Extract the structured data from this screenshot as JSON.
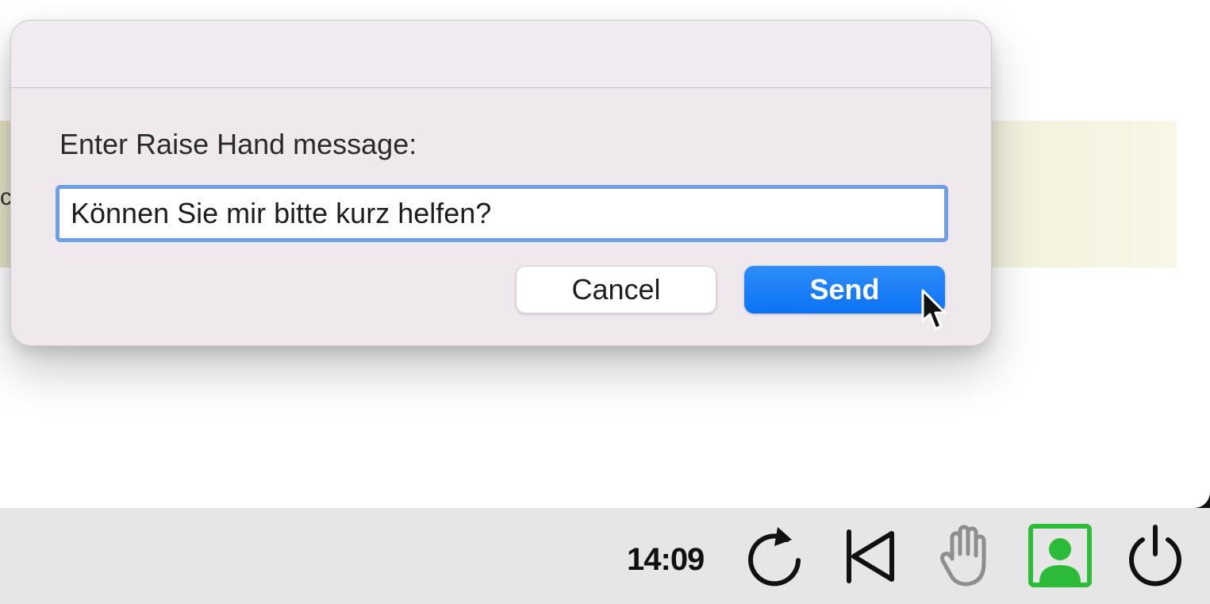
{
  "background": {
    "banner_fragment": "c"
  },
  "dialog": {
    "prompt": "Enter Raise Hand message:",
    "input_value": "Können Sie mir bitte kurz helfen?",
    "cancel_label": "Cancel",
    "send_label": "Send"
  },
  "taskbar": {
    "time": "14:09",
    "icons": [
      "reload-icon",
      "back-icon",
      "raise-hand-icon",
      "profile-icon",
      "power-icon"
    ]
  },
  "colors": {
    "accent": "#0a72f2",
    "input_focus": "#6f9ee8",
    "profile_green": "#2dbb3a",
    "hand_gray": "#8e8e8e"
  }
}
